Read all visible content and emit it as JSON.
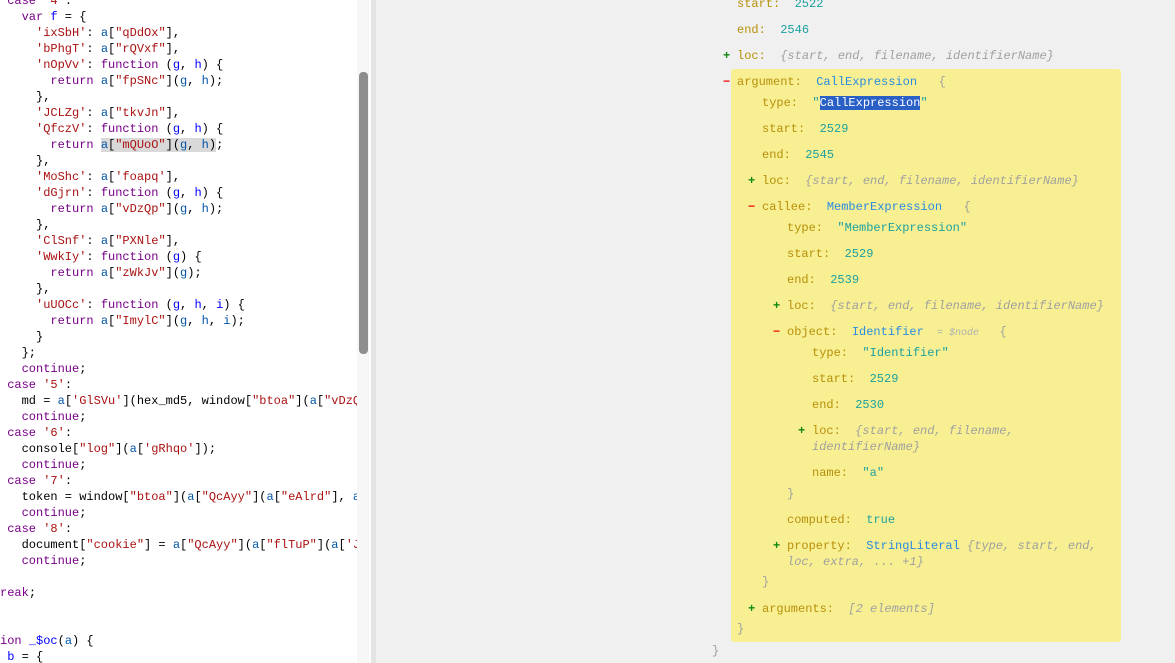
{
  "code_editor": {
    "lines": [
      [
        1,
        [
          [
            "kw",
            "case"
          ],
          [
            "pl",
            " "
          ],
          [
            "str",
            "'4'"
          ],
          [
            "pl",
            ":"
          ]
        ]
      ],
      [
        3,
        [
          [
            "kw",
            "var"
          ],
          [
            "pl",
            " "
          ],
          [
            "def",
            "f"
          ],
          [
            "pl",
            " = {"
          ]
        ]
      ],
      [
        5,
        [
          [
            "str",
            "'ixSbH'"
          ],
          [
            "pl",
            ": "
          ],
          [
            "var",
            "a"
          ],
          [
            "pl",
            "["
          ],
          [
            "str",
            "\"qDdOx\""
          ],
          [
            "pl",
            "],"
          ]
        ]
      ],
      [
        5,
        [
          [
            "str",
            "'bPhgT'"
          ],
          [
            "pl",
            ": "
          ],
          [
            "var",
            "a"
          ],
          [
            "pl",
            "["
          ],
          [
            "str",
            "\"rQVxf\""
          ],
          [
            "pl",
            "],"
          ]
        ]
      ],
      [
        5,
        [
          [
            "str",
            "'nOpVv'"
          ],
          [
            "pl",
            ": "
          ],
          [
            "kw",
            "function"
          ],
          [
            "pl",
            " ("
          ],
          [
            "def",
            "g"
          ],
          [
            "pl",
            ", "
          ],
          [
            "def",
            "h"
          ],
          [
            "pl",
            ") {"
          ]
        ]
      ],
      [
        7,
        [
          [
            "kw",
            "return"
          ],
          [
            "pl",
            " "
          ],
          [
            "var",
            "a"
          ],
          [
            "pl",
            "["
          ],
          [
            "str",
            "\"fpSNc\""
          ],
          [
            "pl",
            "]("
          ],
          [
            "var",
            "g"
          ],
          [
            "pl",
            ", "
          ],
          [
            "var",
            "h"
          ],
          [
            "pl",
            ");"
          ]
        ]
      ],
      [
        5,
        [
          [
            "pl",
            "},"
          ]
        ]
      ],
      [
        5,
        [
          [
            "str",
            "'JCLZg'"
          ],
          [
            "pl",
            ": "
          ],
          [
            "var",
            "a"
          ],
          [
            "pl",
            "["
          ],
          [
            "str",
            "\"tkvJn\""
          ],
          [
            "pl",
            "],"
          ]
        ]
      ],
      [
        5,
        [
          [
            "str",
            "'QfczV'"
          ],
          [
            "pl",
            ": "
          ],
          [
            "kw",
            "function"
          ],
          [
            "pl",
            " ("
          ],
          [
            "def",
            "g"
          ],
          [
            "pl",
            ", "
          ],
          [
            "def",
            "h"
          ],
          [
            "pl",
            ") {"
          ]
        ]
      ],
      [
        7,
        [
          [
            "kw",
            "return"
          ],
          [
            "pl",
            " "
          ],
          [
            "var hl",
            "a"
          ],
          [
            "pl hl",
            "["
          ],
          [
            "str hl",
            "\"mQUoO\""
          ],
          [
            "pl hl",
            "]("
          ],
          [
            "var hl",
            "g"
          ],
          [
            "pl hl",
            ", "
          ],
          [
            "var hl",
            "h"
          ],
          [
            "pl hl",
            ")"
          ],
          [
            "pl",
            ";"
          ]
        ]
      ],
      [
        5,
        [
          [
            "pl",
            "},"
          ]
        ]
      ],
      [
        5,
        [
          [
            "str",
            "'MoShc'"
          ],
          [
            "pl",
            ": "
          ],
          [
            "var",
            "a"
          ],
          [
            "pl",
            "["
          ],
          [
            "str",
            "'foapq'"
          ],
          [
            "pl",
            "],"
          ]
        ]
      ],
      [
        5,
        [
          [
            "str",
            "'dGjrn'"
          ],
          [
            "pl",
            ": "
          ],
          [
            "kw",
            "function"
          ],
          [
            "pl",
            " ("
          ],
          [
            "def",
            "g"
          ],
          [
            "pl",
            ", "
          ],
          [
            "def",
            "h"
          ],
          [
            "pl",
            ") {"
          ]
        ]
      ],
      [
        7,
        [
          [
            "kw",
            "return"
          ],
          [
            "pl",
            " "
          ],
          [
            "var",
            "a"
          ],
          [
            "pl",
            "["
          ],
          [
            "str",
            "\"vDzQp\""
          ],
          [
            "pl",
            "]("
          ],
          [
            "var",
            "g"
          ],
          [
            "pl",
            ", "
          ],
          [
            "var",
            "h"
          ],
          [
            "pl",
            ");"
          ]
        ]
      ],
      [
        5,
        [
          [
            "pl",
            "},"
          ]
        ]
      ],
      [
        5,
        [
          [
            "str",
            "'ClSnf'"
          ],
          [
            "pl",
            ": "
          ],
          [
            "var",
            "a"
          ],
          [
            "pl",
            "["
          ],
          [
            "str",
            "\"PXNle\""
          ],
          [
            "pl",
            "],"
          ]
        ]
      ],
      [
        5,
        [
          [
            "str",
            "'WwkIy'"
          ],
          [
            "pl",
            ": "
          ],
          [
            "kw",
            "function"
          ],
          [
            "pl",
            " ("
          ],
          [
            "def",
            "g"
          ],
          [
            "pl",
            ") {"
          ]
        ]
      ],
      [
        7,
        [
          [
            "kw",
            "return"
          ],
          [
            "pl",
            " "
          ],
          [
            "var",
            "a"
          ],
          [
            "pl",
            "["
          ],
          [
            "str",
            "\"zWkJv\""
          ],
          [
            "pl",
            "]("
          ],
          [
            "var",
            "g"
          ],
          [
            "pl",
            ");"
          ]
        ]
      ],
      [
        5,
        [
          [
            "pl",
            "},"
          ]
        ]
      ],
      [
        5,
        [
          [
            "str",
            "'uUOCc'"
          ],
          [
            "pl",
            ": "
          ],
          [
            "kw",
            "function"
          ],
          [
            "pl",
            " ("
          ],
          [
            "def",
            "g"
          ],
          [
            "pl",
            ", "
          ],
          [
            "def",
            "h"
          ],
          [
            "pl",
            ", "
          ],
          [
            "def",
            "i"
          ],
          [
            "pl",
            ") {"
          ]
        ]
      ],
      [
        7,
        [
          [
            "kw",
            "return"
          ],
          [
            "pl",
            " "
          ],
          [
            "var",
            "a"
          ],
          [
            "pl",
            "["
          ],
          [
            "str",
            "\"ImylC\""
          ],
          [
            "pl",
            "]("
          ],
          [
            "var",
            "g"
          ],
          [
            "pl",
            ", "
          ],
          [
            "var",
            "h"
          ],
          [
            "pl",
            ", "
          ],
          [
            "var",
            "i"
          ],
          [
            "pl",
            ");"
          ]
        ]
      ],
      [
        5,
        [
          [
            "pl",
            "}"
          ]
        ]
      ],
      [
        3,
        [
          [
            "pl",
            "};"
          ]
        ]
      ],
      [
        3,
        [
          [
            "kw",
            "continue"
          ],
          [
            "pl",
            ";"
          ]
        ]
      ],
      [
        1,
        [
          [
            "kw",
            "case"
          ],
          [
            "pl",
            " "
          ],
          [
            "str",
            "'5'"
          ],
          [
            "pl",
            ":"
          ]
        ]
      ],
      [
        3,
        [
          [
            "pl",
            "md = "
          ],
          [
            "var",
            "a"
          ],
          [
            "pl",
            "["
          ],
          [
            "str",
            "'GlSVu'"
          ],
          [
            "pl",
            "](hex_md5, window["
          ],
          [
            "str",
            "\"btoa\""
          ],
          [
            "pl",
            "]("
          ],
          [
            "var",
            "a"
          ],
          [
            "pl",
            "["
          ],
          [
            "str",
            "\"vDzQp"
          ]
        ]
      ],
      [
        3,
        [
          [
            "kw",
            "continue"
          ],
          [
            "pl",
            ";"
          ]
        ]
      ],
      [
        1,
        [
          [
            "kw",
            "case"
          ],
          [
            "pl",
            " "
          ],
          [
            "str",
            "'6'"
          ],
          [
            "pl",
            ":"
          ]
        ]
      ],
      [
        3,
        [
          [
            "pl",
            "console["
          ],
          [
            "str",
            "\"log\""
          ],
          [
            "pl",
            "]("
          ],
          [
            "var",
            "a"
          ],
          [
            "pl",
            "["
          ],
          [
            "str",
            "'gRhqo'"
          ],
          [
            "pl",
            "]);"
          ]
        ]
      ],
      [
        3,
        [
          [
            "kw",
            "continue"
          ],
          [
            "pl",
            ";"
          ]
        ]
      ],
      [
        1,
        [
          [
            "kw",
            "case"
          ],
          [
            "pl",
            " "
          ],
          [
            "str",
            "'7'"
          ],
          [
            "pl",
            ":"
          ]
        ]
      ],
      [
        3,
        [
          [
            "pl",
            "token = window["
          ],
          [
            "str",
            "\"btoa\""
          ],
          [
            "pl",
            "]("
          ],
          [
            "var",
            "a"
          ],
          [
            "pl",
            "["
          ],
          [
            "str",
            "\"QcAyy\""
          ],
          [
            "pl",
            "]("
          ],
          [
            "var",
            "a"
          ],
          [
            "pl",
            "["
          ],
          [
            "str",
            "\"eAlrd\""
          ],
          [
            "pl",
            "], "
          ],
          [
            "var",
            "a"
          ],
          [
            "pl",
            "["
          ]
        ]
      ],
      [
        3,
        [
          [
            "kw",
            "continue"
          ],
          [
            "pl",
            ";"
          ]
        ]
      ],
      [
        1,
        [
          [
            "kw",
            "case"
          ],
          [
            "pl",
            " "
          ],
          [
            "str",
            "'8'"
          ],
          [
            "pl",
            ":"
          ]
        ]
      ],
      [
        3,
        [
          [
            "pl",
            "document["
          ],
          [
            "str",
            "\"cookie\""
          ],
          [
            "pl",
            "] = "
          ],
          [
            "var",
            "a"
          ],
          [
            "pl",
            "["
          ],
          [
            "str",
            "\"QcAyy\""
          ],
          [
            "pl",
            "]("
          ],
          [
            "var",
            "a"
          ],
          [
            "pl",
            "["
          ],
          [
            "str",
            "\"flTuP\""
          ],
          [
            "pl",
            "]("
          ],
          [
            "var",
            "a"
          ],
          [
            "pl",
            "["
          ],
          [
            "str",
            "'Jt"
          ]
        ]
      ],
      [
        3,
        [
          [
            "kw",
            "continue"
          ],
          [
            "pl",
            ";"
          ]
        ]
      ],
      [
        0,
        []
      ],
      [
        0,
        [
          [
            "kw",
            "reak"
          ],
          [
            "pl",
            ";"
          ]
        ]
      ],
      [
        0,
        []
      ],
      [
        0,
        []
      ],
      [
        0,
        [
          [
            "kw",
            "ion"
          ],
          [
            "pl",
            " "
          ],
          [
            "def",
            "_$oc"
          ],
          [
            "pl",
            "("
          ],
          [
            "var",
            "a"
          ],
          [
            "pl",
            ") {"
          ]
        ]
      ],
      [
        1,
        [
          [
            "def",
            "b"
          ],
          [
            "pl",
            " = {"
          ]
        ]
      ]
    ]
  },
  "ast_tree": {
    "rows": [
      {
        "depth": 0,
        "key": "start",
        "num": "2522"
      },
      {
        "depth": 0,
        "key": "end",
        "num": "2546"
      },
      {
        "depth": 0,
        "toggle": "+",
        "key": "loc",
        "summary": "{start, end, filename, identifierName}"
      },
      {
        "depth": 0,
        "toggle": "-",
        "key": "argument",
        "type": "CallExpression",
        "brace": "{"
      },
      {
        "depth": 1,
        "key": "type",
        "selected": "CallExpression"
      },
      {
        "depth": 1,
        "key": "start",
        "num": "2529"
      },
      {
        "depth": 1,
        "key": "end",
        "num": "2545"
      },
      {
        "depth": 1,
        "toggle": "+",
        "key": "loc",
        "summary": "{start, end, filename, identifierName}"
      },
      {
        "depth": 1,
        "toggle": "-",
        "key": "callee",
        "type": "MemberExpression",
        "brace": "{"
      },
      {
        "depth": 2,
        "key": "type",
        "num": "\"MemberExpression\""
      },
      {
        "depth": 2,
        "key": "start",
        "num": "2529"
      },
      {
        "depth": 2,
        "key": "end",
        "num": "2539"
      },
      {
        "depth": 2,
        "toggle": "+",
        "key": "loc",
        "summary": "{start, end, filename, identifierName}"
      },
      {
        "depth": 2,
        "toggle": "-",
        "key": "object",
        "type": "Identifier",
        "tag": "= $node",
        "brace": "{"
      },
      {
        "depth": 3,
        "key": "type",
        "num": "\"Identifier\""
      },
      {
        "depth": 3,
        "key": "start",
        "num": "2529"
      },
      {
        "depth": 3,
        "key": "end",
        "num": "2530"
      },
      {
        "depth": 3,
        "toggle": "+",
        "key": "loc",
        "summary": "{start, end, filename,",
        "summary2": "identifierName}"
      },
      {
        "depth": 3,
        "key": "name",
        "num": "\"a\""
      },
      {
        "depth": 2,
        "close": "}"
      },
      {
        "depth": 2,
        "key": "computed",
        "num": "true"
      },
      {
        "depth": 2,
        "toggle": "+",
        "key": "property",
        "type": "StringLiteral",
        "summary": "{type, start, end,",
        "summary2": "loc, extra, ... +1}"
      },
      {
        "depth": 1,
        "close": "}"
      },
      {
        "depth": 1,
        "toggle": "+",
        "key": "arguments",
        "summary": "[2 elements]"
      },
      {
        "depth": 0,
        "close": "}"
      },
      {
        "depth": -1,
        "close": "}"
      }
    ]
  },
  "colors": {
    "highlight_box": "#f7ef92",
    "selection": "#2a5fc6",
    "keyword": "#770088",
    "string": "#aa1111"
  }
}
